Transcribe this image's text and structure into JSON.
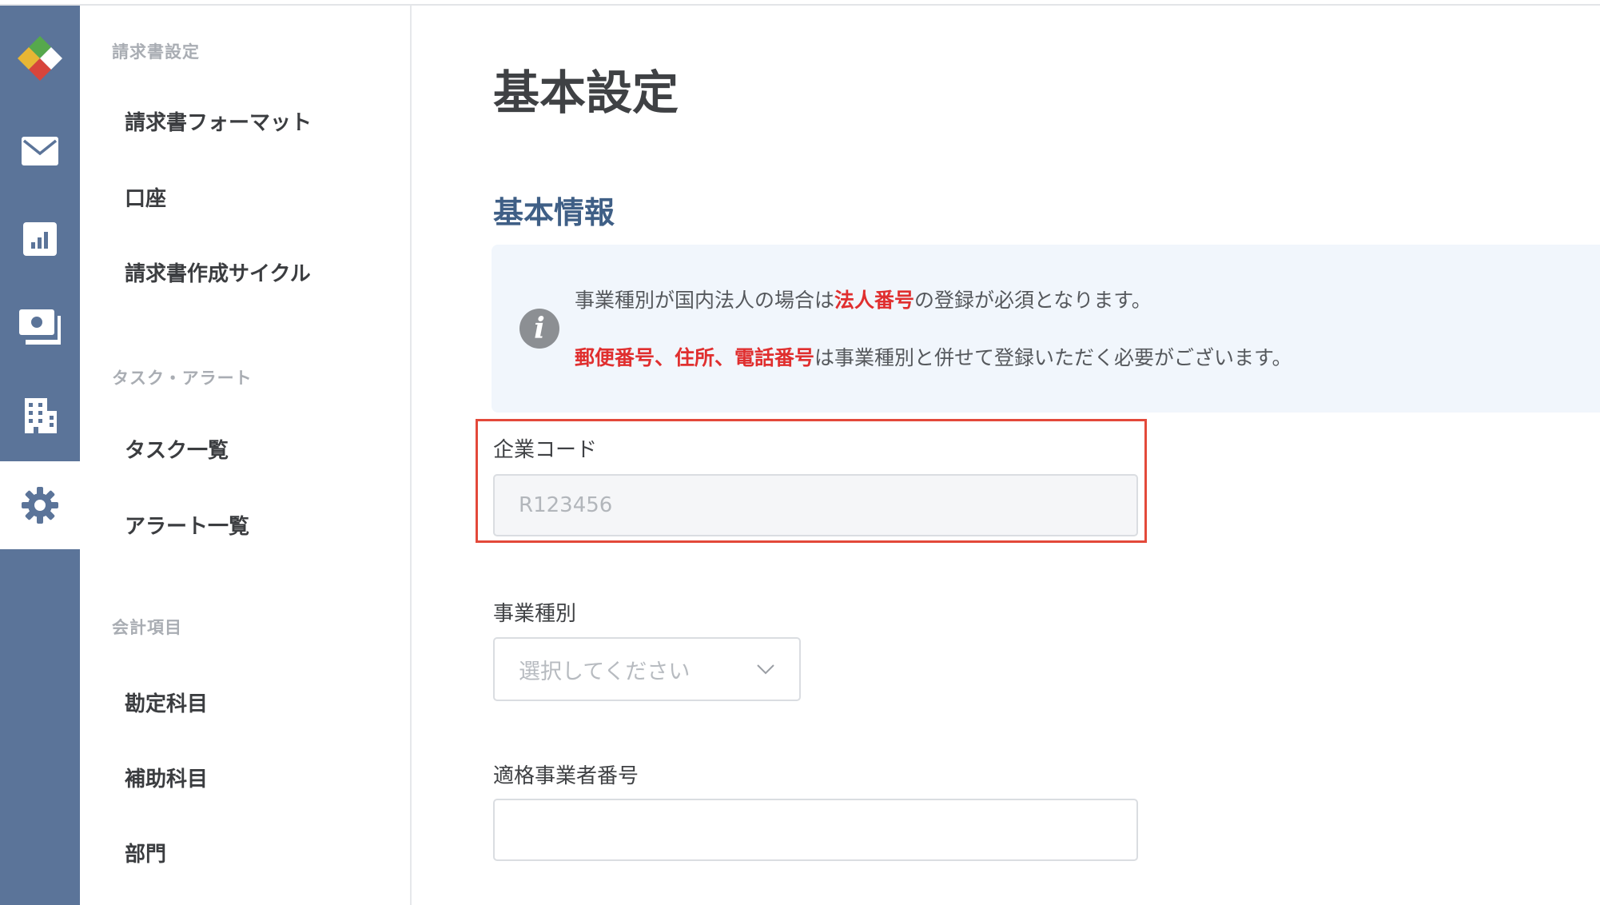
{
  "rail": {
    "icons": [
      "app-logo-icon",
      "mail-icon",
      "chart-icon",
      "payment-icon",
      "building-icon",
      "gear-icon"
    ],
    "active": "gear-icon",
    "colors": {
      "rail_bg": "#5b7499",
      "active_bg": "#ffffff"
    }
  },
  "subnav": {
    "sections": [
      {
        "heading": "請求書設定",
        "items": [
          "請求書フォーマット",
          "口座",
          "請求書作成サイクル"
        ]
      },
      {
        "heading": "タスク・アラート",
        "items": [
          "タスク一覧",
          "アラート一覧"
        ]
      },
      {
        "heading": "会計項目",
        "items": [
          "勘定科目",
          "補助科目",
          "部門"
        ]
      }
    ]
  },
  "main": {
    "page_title": "基本設定",
    "section_title": "基本情報",
    "info": {
      "line1": {
        "a": "事業種別が国内法人の場合は",
        "b": "法人番号",
        "c": "の登録が必須となります。"
      },
      "line2": {
        "a": "郵便番号、住所、電話番号",
        "b": "は事業種別と併せて登録いただく必要がございます。"
      }
    },
    "fields": {
      "company_code": {
        "label": "企業コード",
        "value": "R123456"
      },
      "business_type": {
        "label": "事業種別",
        "placeholder": "選択してください"
      },
      "invoice_number": {
        "label": "適格事業者番号",
        "value": ""
      }
    },
    "colors": {
      "accent_red": "#e02f2f",
      "highlight_border": "#e3493a",
      "section_title": "#3f5f86"
    }
  }
}
